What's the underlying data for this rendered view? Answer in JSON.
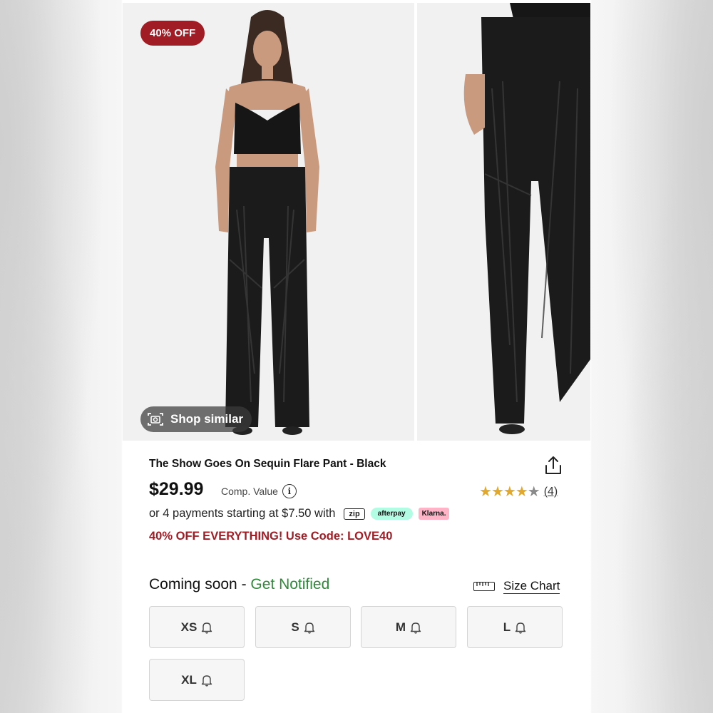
{
  "badge": {
    "discount": "40% OFF"
  },
  "gallery": {
    "shop_similar_label": "Shop similar"
  },
  "product": {
    "title": "The Show Goes On Sequin Flare Pant - Black",
    "price": "$29.99",
    "comp_value_label": "Comp. Value",
    "rating": {
      "stars": 4,
      "max": 5,
      "count": "(4)"
    },
    "payments_text": "or 4 payments starting at $7.50 with",
    "payment_providers": [
      "zip",
      "afterpay",
      "Klarna."
    ],
    "promo": "40% OFF EVERYTHING! Use Code: LOVE40"
  },
  "availability": {
    "coming_soon": "Coming soon - ",
    "get_notified": "Get Notified",
    "size_chart_label": "Size Chart"
  },
  "sizes": [
    "XS",
    "S",
    "M",
    "L",
    "XL"
  ],
  "colors": {
    "badge_bg": "#a11d25",
    "promo_text": "#a11d25",
    "notify_text": "#2f8a3a",
    "star": "#e0a82e"
  }
}
